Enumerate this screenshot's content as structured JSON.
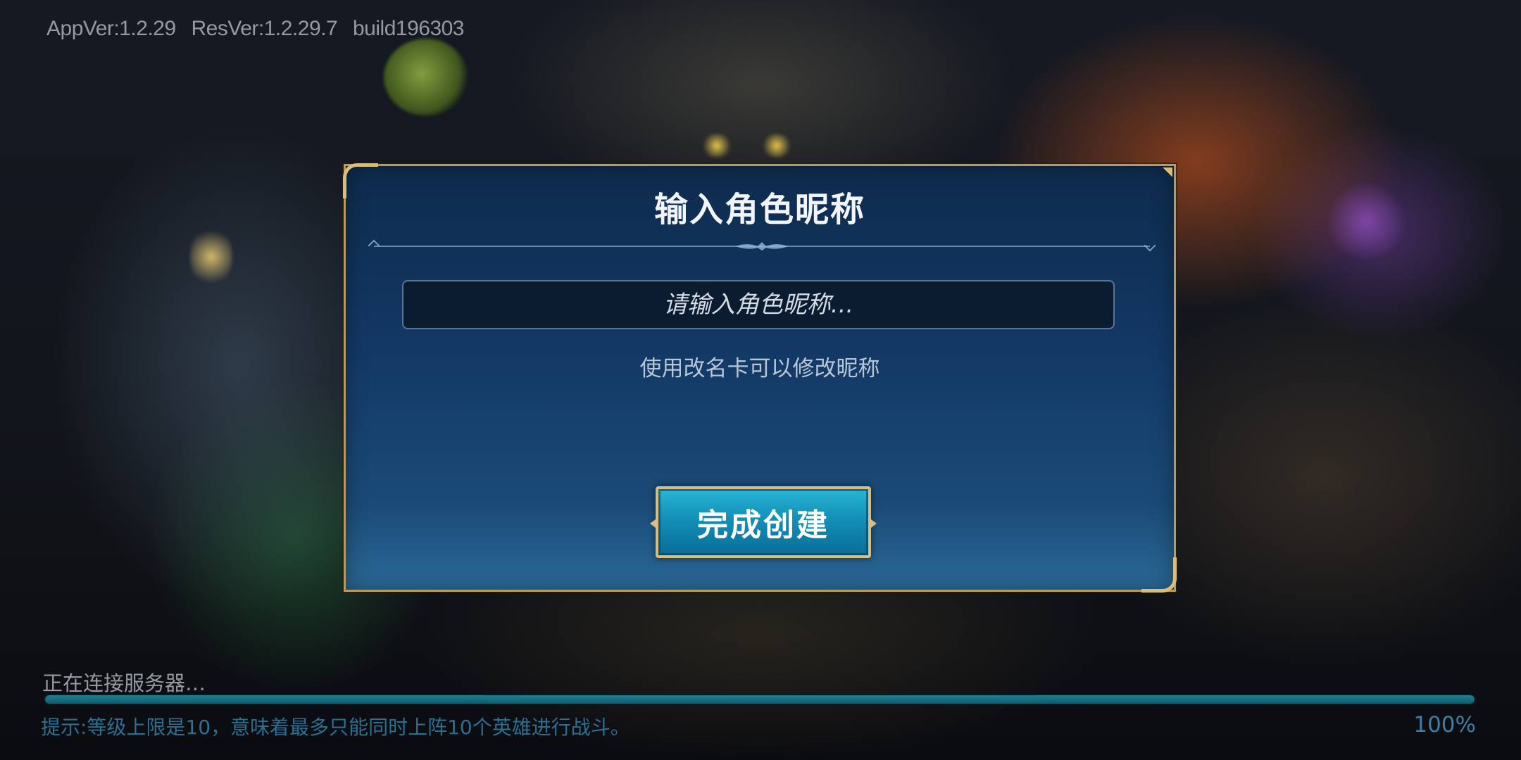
{
  "version": {
    "app": "AppVer:1.2.29",
    "res": "ResVer:1.2.29.7",
    "build": "build196303"
  },
  "dialog": {
    "title": "输入角色昵称",
    "input_placeholder": "请输入角色昵称...",
    "input_value": "",
    "hint": "使用改名卡可以修改昵称",
    "confirm_label": "完成创建"
  },
  "loading": {
    "status": "正在连接服务器…",
    "progress": 1.0,
    "percent_label": "100%",
    "tip": "提示:等级上限是10，意味着最多只能同时上阵10个英雄进行战斗。"
  },
  "colors": {
    "dialog_border": "#b69a5e",
    "button_fill": "#138fb8",
    "progress_fill": "#0f5d6e"
  }
}
